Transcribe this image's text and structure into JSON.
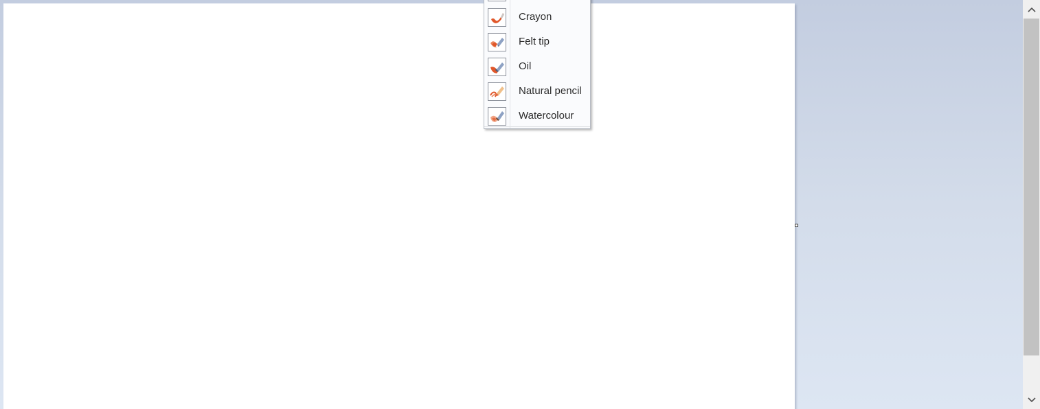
{
  "colors": {
    "workspace_top": "#c3cde0",
    "workspace_bottom": "#dde6f3",
    "canvas": "#ffffff",
    "menu_bg": "#fafbfd",
    "brush_orange": "#e0572a",
    "scroll_thumb": "#c2c2c2"
  },
  "scrollbar": {
    "up_icon": "chevron-up-icon",
    "down_icon": "chevron-down-icon",
    "up_glyph": "⌃",
    "down_glyph": "⌄"
  },
  "brush_menu": {
    "items": [
      {
        "label": "Crayon",
        "icon": "crayon-brush-icon"
      },
      {
        "label": "Felt tip",
        "icon": "felt-tip-brush-icon"
      },
      {
        "label": "Oil",
        "icon": "oil-brush-icon"
      },
      {
        "label": "Natural pencil",
        "icon": "natural-pencil-brush-icon"
      },
      {
        "label": "Watercolour",
        "icon": "watercolour-brush-icon"
      }
    ]
  }
}
